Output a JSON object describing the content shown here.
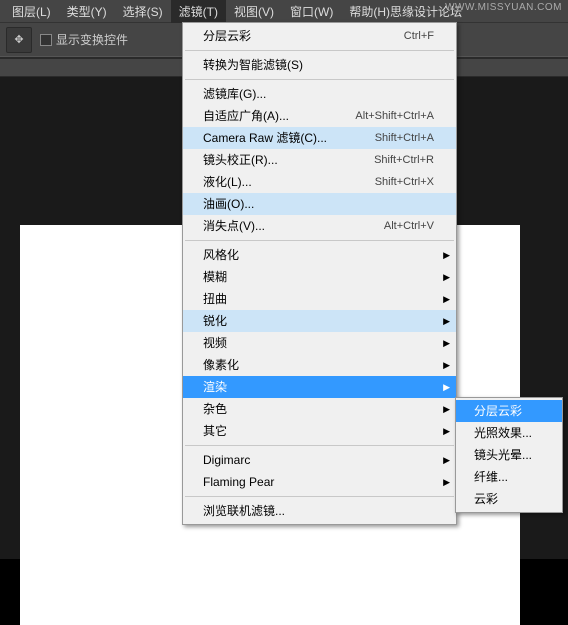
{
  "watermark": "WWW.MISSYUAN.COM",
  "menubar": [
    "图层(L)",
    "类型(Y)",
    "选择(S)",
    "滤镜(T)",
    "视图(V)",
    "窗口(W)",
    "帮助(H)思缘设计论坛"
  ],
  "menubar_active_index": 3,
  "toolbar": {
    "checkbox_label": "显示变换控件"
  },
  "dropdown": [
    {
      "label": "分层云彩",
      "shortcut": "Ctrl+F"
    },
    {
      "sep": true
    },
    {
      "label": "转换为智能滤镜(S)"
    },
    {
      "sep": true
    },
    {
      "label": "滤镜库(G)..."
    },
    {
      "label": "自适应广角(A)...",
      "shortcut": "Alt+Shift+Ctrl+A"
    },
    {
      "label": "Camera Raw 滤镜(C)...",
      "shortcut": "Shift+Ctrl+A",
      "hover": true
    },
    {
      "label": "镜头校正(R)...",
      "shortcut": "Shift+Ctrl+R"
    },
    {
      "label": "液化(L)...",
      "shortcut": "Shift+Ctrl+X"
    },
    {
      "label": "油画(O)...",
      "hover": true
    },
    {
      "label": "消失点(V)...",
      "shortcut": "Alt+Ctrl+V"
    },
    {
      "sep": true
    },
    {
      "label": "风格化",
      "sub": true
    },
    {
      "label": "模糊",
      "sub": true
    },
    {
      "label": "扭曲",
      "sub": true
    },
    {
      "label": "锐化",
      "sub": true,
      "hover": true
    },
    {
      "label": "视频",
      "sub": true
    },
    {
      "label": "像素化",
      "sub": true
    },
    {
      "label": "渲染",
      "sub": true,
      "selected": true
    },
    {
      "label": "杂色",
      "sub": true
    },
    {
      "label": "其它",
      "sub": true
    },
    {
      "sep": true
    },
    {
      "label": "Digimarc",
      "sub": true
    },
    {
      "label": "Flaming Pear",
      "sub": true
    },
    {
      "sep": true
    },
    {
      "label": "浏览联机滤镜..."
    }
  ],
  "submenu": [
    {
      "label": "分层云彩",
      "selected": true
    },
    {
      "label": "光照效果..."
    },
    {
      "label": "镜头光晕..."
    },
    {
      "label": "纤维..."
    },
    {
      "label": "云彩"
    }
  ]
}
